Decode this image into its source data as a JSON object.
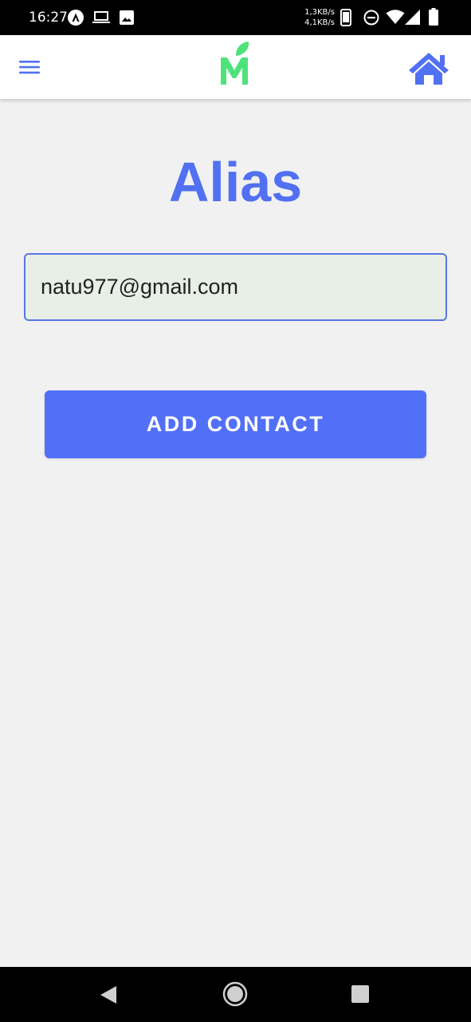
{
  "status_bar": {
    "time": "16:27",
    "net_up": "1,3KB/s",
    "net_down": "4,1KB/s",
    "icons": [
      "app-a-icon",
      "laptop-icon",
      "image-icon",
      "phone-icon",
      "do-not-disturb-icon",
      "wifi-icon",
      "signal-icon",
      "battery-icon"
    ]
  },
  "app_bar": {
    "logo_letter": "M",
    "icons": [
      "hamburger-menu-icon",
      "home-icon"
    ]
  },
  "main": {
    "title": "Alias",
    "alias_value": "natu977@gmail.com",
    "add_button_label": "ADD CONTACT"
  },
  "nav_bar": {
    "icons": [
      "back-icon",
      "home-circle-icon",
      "recents-icon"
    ]
  },
  "colors": {
    "accent": "#5170f2",
    "input_bg": "#e8efe6",
    "logo_green": "#4ee37a",
    "background": "#f1f1f1"
  }
}
